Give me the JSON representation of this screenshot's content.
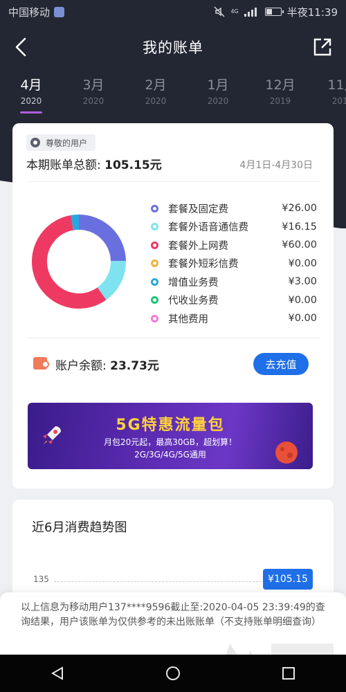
{
  "status_bar": {
    "carrier": "中国移动",
    "network": "4G",
    "time": "半夜11:39"
  },
  "nav": {
    "title": "我的账单"
  },
  "month_tabs": [
    {
      "month": "4月",
      "year": "2020",
      "active": true
    },
    {
      "month": "3月",
      "year": "2020",
      "active": false
    },
    {
      "month": "2月",
      "year": "2020",
      "active": false
    },
    {
      "month": "1月",
      "year": "2020",
      "active": false
    },
    {
      "month": "12月",
      "year": "2019",
      "active": false
    },
    {
      "month": "11月",
      "year": "2019",
      "active": false
    }
  ],
  "bill": {
    "user_badge": "尊敬的用户",
    "total_label": "本期账单总额:",
    "total_value": "105.15元",
    "period": "4月1日-4月30日",
    "breakdown": [
      {
        "label": "套餐及固定费",
        "value": "¥26.00",
        "amount": 26.0,
        "color": "#6a6fe0"
      },
      {
        "label": "套餐外语音通信费",
        "value": "¥16.15",
        "amount": 16.15,
        "color": "#7ee3ee"
      },
      {
        "label": "套餐外上网费",
        "value": "¥60.00",
        "amount": 60.0,
        "color": "#ee3a63"
      },
      {
        "label": "套餐外短彩信费",
        "value": "¥0.00",
        "amount": 0,
        "color": "#f4b23c"
      },
      {
        "label": "增值业务费",
        "value": "¥3.00",
        "amount": 3.0,
        "color": "#2aa7e0"
      },
      {
        "label": "代收业务费",
        "value": "¥0.00",
        "amount": 0,
        "color": "#22c27a"
      },
      {
        "label": "其他费用",
        "value": "¥0.00",
        "amount": 0,
        "color": "#f27ad9"
      }
    ]
  },
  "balance": {
    "label": "账户余额:",
    "value": "23.73元",
    "recharge_label": "去充值"
  },
  "banner": {
    "title": "5G特惠流量包",
    "subtitle": "月包20元起，最高30GB，超划算！",
    "networks": "2G/3G/4G/5G通用"
  },
  "trend": {
    "title": "近6月消费趋势图",
    "axis_tick": "135",
    "tip_value": "¥105.15"
  },
  "disclaimer": "以上信息为移动用户137****9596截止至:2020-04-05 23:39:49的查询结果，用户该账单为仅供参考的未出账账单（不支持账单明细查询）"
}
